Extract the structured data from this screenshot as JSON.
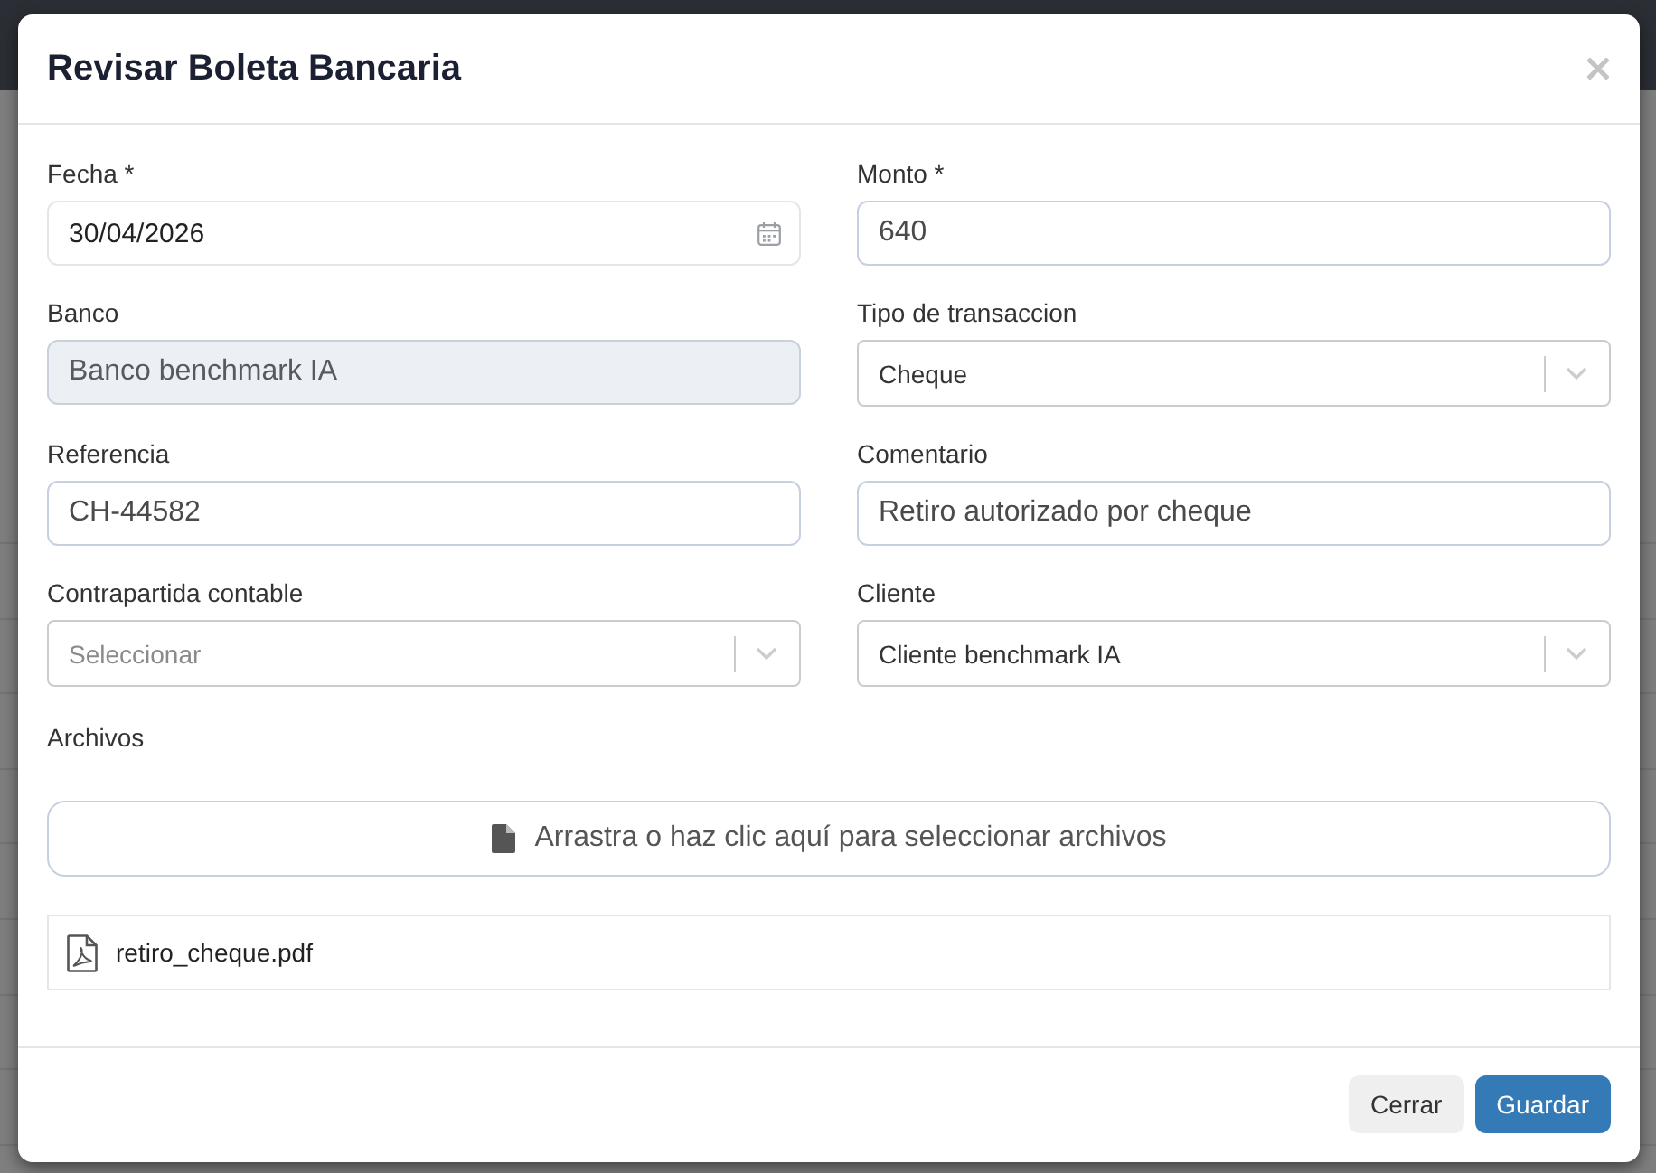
{
  "dialog": {
    "title": "Revisar Boleta Bancaria",
    "fields": [
      {
        "label": "Fecha *",
        "kind": "date",
        "value": "30/04/2026",
        "disabled": false
      },
      {
        "label": "Monto *",
        "kind": "text",
        "value": "640",
        "disabled": false
      },
      {
        "label": "Banco",
        "kind": "text",
        "value": "Banco benchmark IA",
        "disabled": true
      },
      {
        "label": "Tipo de transaccion",
        "kind": "select",
        "value": "Cheque",
        "disabled": false
      },
      {
        "label": "Referencia",
        "kind": "text",
        "value": "CH-44582",
        "disabled": false
      },
      {
        "label": "Comentario",
        "kind": "text",
        "value": "Retiro autorizado por cheque",
        "disabled": false
      },
      {
        "label": "Contrapartida contable",
        "kind": "select",
        "placeholder": "Seleccionar",
        "disabled": false
      },
      {
        "label": "Cliente",
        "kind": "select",
        "value": "Cliente benchmark IA",
        "disabled": false
      }
    ],
    "files": {
      "label": "Archivos",
      "dropzone": "Arrastra o haz clic aquí para seleccionar archivos",
      "items": [
        {
          "name": "retiro_cheque.pdf"
        }
      ]
    },
    "buttons": [
      {
        "label": "Cerrar",
        "kind": "secondary"
      },
      {
        "label": "Guardar",
        "kind": "primary"
      }
    ]
  }
}
